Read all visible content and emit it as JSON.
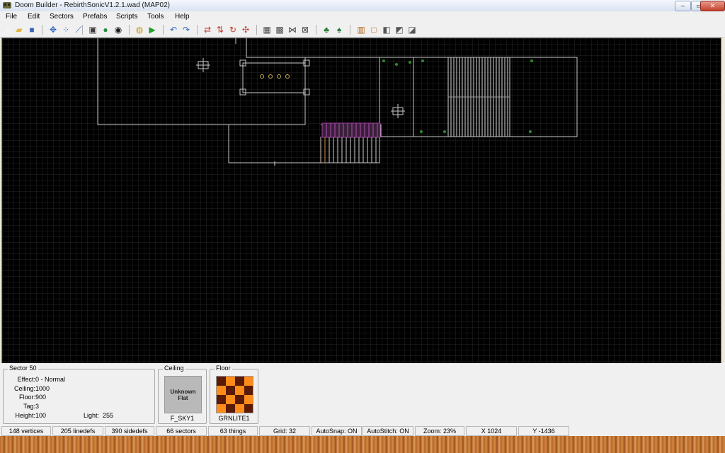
{
  "window": {
    "title": "Doom Builder - RebirthSonicV1.2.1.wad (MAP02)",
    "minimize": "–",
    "maximize": "▭",
    "close": "✕"
  },
  "menu": [
    "File",
    "Edit",
    "Sectors",
    "Prefabs",
    "Scripts",
    "Tools",
    "Help"
  ],
  "toolbar_icons": [
    {
      "name": "new-file-icon",
      "glyph": "▫",
      "color": "#ffffff"
    },
    {
      "name": "open-folder-icon",
      "glyph": "▰",
      "color": "#e2b43c"
    },
    {
      "name": "save-icon",
      "glyph": "■",
      "color": "#3a64b5"
    },
    {
      "name": "move-mode-icon",
      "glyph": "✥",
      "color": "#2d66c8"
    },
    {
      "name": "vertices-mode-icon",
      "glyph": "⁘",
      "color": "#2d66c8"
    },
    {
      "name": "linedefs-mode-icon",
      "glyph": "⟋",
      "color": "#2d66c8"
    },
    {
      "name": "sectors-mode-icon",
      "glyph": "▣",
      "color": "#3c3c3c"
    },
    {
      "name": "things-mode-icon",
      "glyph": "●",
      "color": "#2b8a3e"
    },
    {
      "name": "3d-mode-icon",
      "glyph": "◉",
      "color": "#1b1b1b"
    },
    {
      "name": "build-nodes-icon",
      "glyph": "◍",
      "color": "#c99a1d"
    },
    {
      "name": "test-map-icon",
      "glyph": "▶",
      "color": "#1f9e2c"
    },
    {
      "name": "undo-icon",
      "glyph": "↶",
      "color": "#2d66c8"
    },
    {
      "name": "redo-icon",
      "glyph": "↷",
      "color": "#2d66c8"
    },
    {
      "name": "flip-horizontal-icon",
      "glyph": "⇄",
      "color": "#c0392b"
    },
    {
      "name": "flip-vertical-icon",
      "glyph": "⇅",
      "color": "#c0392b"
    },
    {
      "name": "rotate-icon",
      "glyph": "↻",
      "color": "#c0392b"
    },
    {
      "name": "resize-icon",
      "glyph": "✣",
      "color": "#c0392b"
    },
    {
      "name": "grid-icon",
      "glyph": "▦",
      "color": "#4a4a4a"
    },
    {
      "name": "snap-grid-icon",
      "glyph": "▩",
      "color": "#4a4a4a"
    },
    {
      "name": "stitch-icon",
      "glyph": "⋈",
      "color": "#4a4a4a"
    },
    {
      "name": "merge-icon",
      "glyph": "⊠",
      "color": "#4a4a4a"
    },
    {
      "name": "prefab-tree-icon",
      "glyph": "♣",
      "color": "#1e7a2e"
    },
    {
      "name": "prefab-insert-icon",
      "glyph": "♠",
      "color": "#1e7a2e"
    },
    {
      "name": "view-lines-icon",
      "glyph": "▥",
      "color": "#b5651d"
    },
    {
      "name": "view-normal-icon",
      "glyph": "□",
      "color": "#b5651d"
    },
    {
      "name": "view-brightness-icon",
      "glyph": "◧",
      "color": "#555555"
    },
    {
      "name": "view-floors-icon",
      "glyph": "◩",
      "color": "#555555"
    },
    {
      "name": "view-ceilings-icon",
      "glyph": "◪",
      "color": "#555555"
    }
  ],
  "sector_info": {
    "title": "Sector 50",
    "effect_label": "Effect:",
    "effect_value": "0 - Normal",
    "ceiling_label": "Ceiling:",
    "ceiling_value": "1000",
    "floor_label": "Floor:",
    "floor_value": "900",
    "tag_label": "Tag:",
    "tag_value": "3",
    "height_label": "Height:",
    "height_value": "100",
    "light_label": "Light:",
    "light_value": "255"
  },
  "ceiling": {
    "title": "Ceiling",
    "preview_text": "Unknown Flat",
    "flat_name": "F_SKY1"
  },
  "floor": {
    "title": "Floor",
    "flat_name": "GRNLITE1",
    "color_a": "#ff8c1a",
    "color_b": "#5a1a05"
  },
  "status": {
    "vertices": "148 vertices",
    "linedefs": "205 linedefs",
    "sidedefs": "390 sidedefs",
    "sectors": "66 sectors",
    "things": "63 things",
    "grid": "Grid: 32",
    "autosnap": "AutoSnap: ON",
    "autostitch": "AutoStitch: ON",
    "zoom": "Zoom: 23%",
    "x": "X 1024",
    "y": "Y -1436"
  },
  "colors": {
    "map_background": "#000000",
    "map_grid": "#2a2a2a",
    "map_lines": "#c8c8c8",
    "highlight_sector": "#a040a0",
    "thing_marker": "#2d8a2d"
  }
}
